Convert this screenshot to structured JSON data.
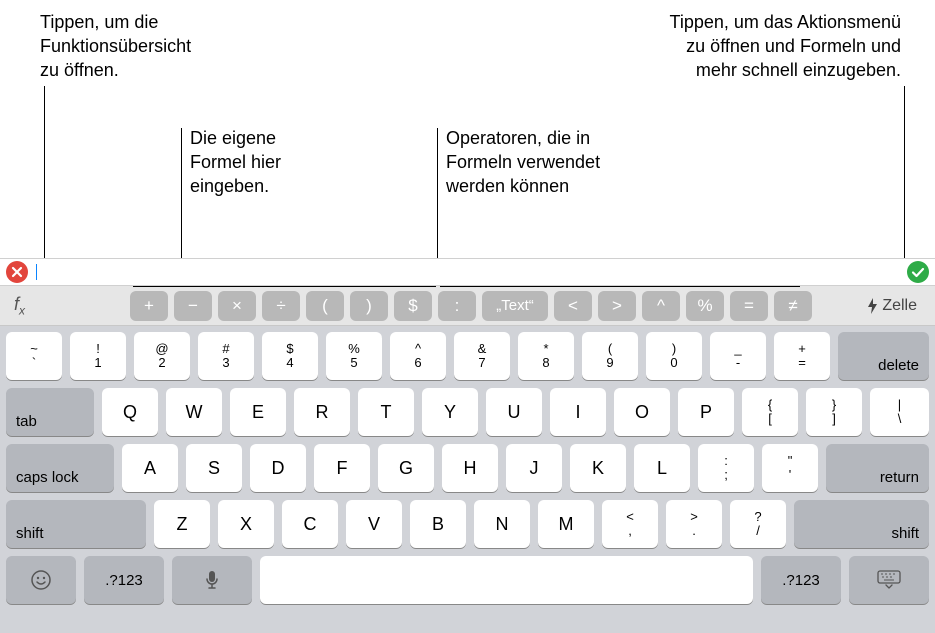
{
  "callouts": {
    "top_left_l1": "Tippen, um die",
    "top_left_l2": "Funktionsübersicht",
    "top_left_l3": "zu öffnen.",
    "top_right_l1": "Tippen, um das Aktionsmenü",
    "top_right_l2": "zu öffnen und Formeln und",
    "top_right_l3": "mehr schnell einzugeben.",
    "mid_left_l1": "Die eigene",
    "mid_left_l2": "Formel hier",
    "mid_left_l3": "eingeben.",
    "mid_right_l1": "Operatoren, die in",
    "mid_right_l2": "Formeln verwendet",
    "mid_right_l3": "werden können"
  },
  "toolbar": {
    "fx_symbol": "f",
    "fx_sub": "x",
    "zelle_label": "Zelle"
  },
  "operators": [
    "+",
    "−",
    "×",
    "÷",
    "(",
    ")",
    "$",
    ":",
    "„Text“",
    "<",
    ">",
    "^",
    "%",
    "=",
    "≠"
  ],
  "keyboard": {
    "row1": [
      {
        "top": "~",
        "bot": "`"
      },
      {
        "top": "!",
        "bot": "1"
      },
      {
        "top": "@",
        "bot": "2"
      },
      {
        "top": "#",
        "bot": "3"
      },
      {
        "top": "$",
        "bot": "4"
      },
      {
        "top": "%",
        "bot": "5"
      },
      {
        "top": "^",
        "bot": "6"
      },
      {
        "top": "&",
        "bot": "7"
      },
      {
        "top": "*",
        "bot": "8"
      },
      {
        "top": "(",
        "bot": "9"
      },
      {
        "top": ")",
        "bot": "0"
      },
      {
        "top": "_",
        "bot": "-"
      },
      {
        "top": "+",
        "bot": "="
      }
    ],
    "delete": "delete",
    "tab": "tab",
    "row2": [
      "Q",
      "W",
      "E",
      "R",
      "T",
      "Y",
      "U",
      "I",
      "O",
      "P"
    ],
    "row2_end": [
      {
        "top": "{",
        "bot": "["
      },
      {
        "top": "}",
        "bot": "]"
      },
      {
        "top": "|",
        "bot": "\\"
      }
    ],
    "caps": "caps lock",
    "row3": [
      "A",
      "S",
      "D",
      "F",
      "G",
      "H",
      "J",
      "K",
      "L"
    ],
    "row3_end": [
      {
        "top": ":",
        "bot": ";"
      },
      {
        "top": "\"",
        "bot": "'"
      }
    ],
    "return": "return",
    "shift": "shift",
    "row4": [
      "Z",
      "X",
      "C",
      "V",
      "B",
      "N",
      "M"
    ],
    "row4_end": [
      {
        "top": "<",
        "bot": ","
      },
      {
        "top": ">",
        "bot": "."
      },
      {
        "top": "?",
        "bot": "/"
      }
    ],
    "globe": ".?123",
    "num": ".?123"
  }
}
